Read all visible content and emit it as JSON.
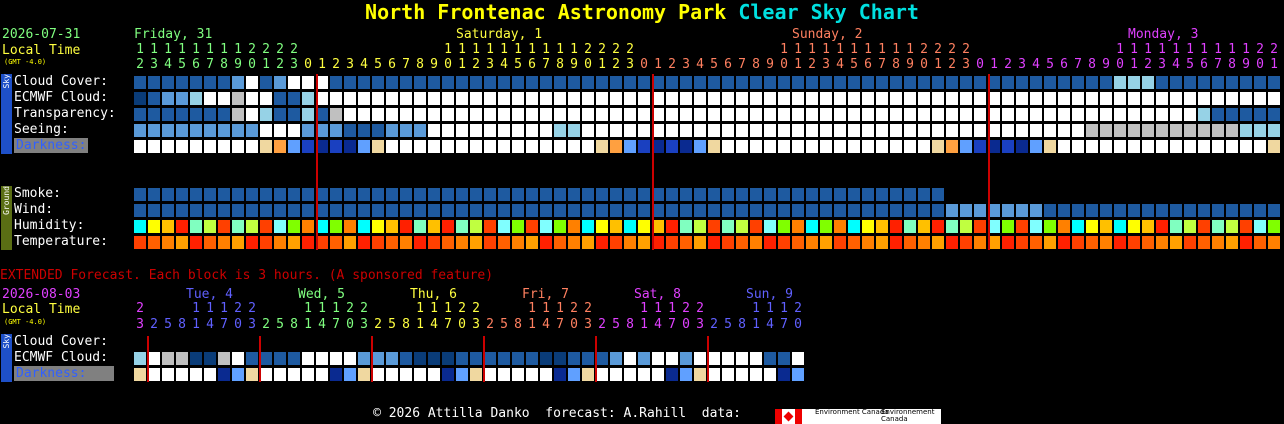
{
  "title": {
    "part1": "North Frontenac Astronomy Park",
    "part2": "Clear Sky Chart"
  },
  "main": {
    "date": "2026-07-31",
    "local_time": "Local Time",
    "gmt": "(GMT -4.0)",
    "days": [
      {
        "label": "Friday, 31",
        "color": "#80ff80"
      },
      {
        "label": "Saturday, 1",
        "color": "#ffff40"
      },
      {
        "label": "Sunday, 2",
        "color": "#ff8060"
      },
      {
        "label": "Monday, 3",
        "color": "#e040ff"
      }
    ],
    "hours_tens": "11111111112222    1111111111222    1111111111222    11111111112",
    "rows": [
      "Cloud Cover:",
      "ECMWF Cloud:",
      "Transparency:",
      "Seeing:",
      "Darkness:"
    ],
    "ground_rows": [
      "Smoke:",
      "Wind:",
      "Humidity:",
      "Temperature:"
    ],
    "side_sky": "Sky",
    "side_ground": "Ground"
  },
  "extended": {
    "notice": "EXTENDED Forecast. Each block is 3 hours. (A sponsored feature)",
    "date": "2026-08-03",
    "local_time": "Local Time",
    "gmt": "(GMT -4.0)",
    "days": [
      {
        "label": "Tue, 4",
        "color": "#6060ff"
      },
      {
        "label": "Wed, 5",
        "color": "#80ff80"
      },
      {
        "label": "Thu, 6",
        "color": "#ffff40"
      },
      {
        "label": "Fri, 7",
        "color": "#ff8060"
      },
      {
        "label": "Sat, 8",
        "color": "#e040ff"
      },
      {
        "label": "Sun, 9",
        "color": "#6060ff"
      }
    ],
    "rows": [
      "Cloud Cover:",
      "ECMWF Cloud:",
      "Darkness:"
    ]
  },
  "footer": {
    "text": "© 2026 Attilla Danko  forecast: A.Rahill  data:",
    "env1": "Environment Canada",
    "env2": "Environnement Canada"
  },
  "colors": {
    "dark_blue": "#0a3c78",
    "mid_blue": "#1e5aa0",
    "light_blue": "#5a9ad8",
    "cyan_pale": "#96d2e6",
    "white": "#ffffff",
    "grey": "#c0c0c0",
    "red_line": "#cc0000"
  }
}
